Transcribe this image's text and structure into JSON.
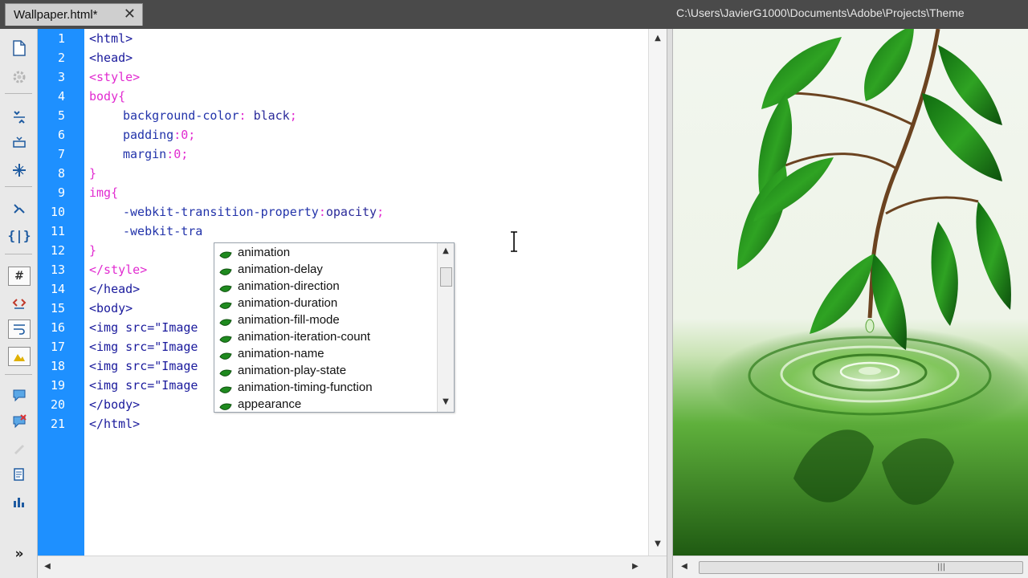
{
  "tab": {
    "label": "Wallpaper.html*",
    "close": "✕"
  },
  "path": "C:\\Users\\JavierG1000\\Documents\\Adobe\\Projects\\Theme",
  "line_numbers": [
    "1",
    "2",
    "3",
    "4",
    "5",
    "6",
    "7",
    "8",
    "9",
    "10",
    "11",
    "12",
    "13",
    "14",
    "15",
    "16",
    "17",
    "18",
    "19",
    "20",
    "21"
  ],
  "code": {
    "l1": "<html>",
    "l2": "<head>",
    "l3": "<style>",
    "l4_sel": "body",
    "l4_brace": "{",
    "l5_prop": "background-color",
    "l5_colon": ": ",
    "l5_val": "black",
    "l5_semi": ";",
    "l6_prop": "padding",
    "l6_colon": ":",
    "l6_val": "0",
    "l6_semi": ";",
    "l7_prop": "margin",
    "l7_colon": ":",
    "l7_val": "0",
    "l7_semi": ";",
    "l8": "}",
    "l9_sel": "img",
    "l9_brace": "{",
    "l10_prop": "-webkit-transition-property",
    "l10_colon": ":",
    "l10_val": "opacity",
    "l10_semi": ";",
    "l11_text": "-webkit-tra",
    "l12": "}",
    "l13": "</style>",
    "l14": "</head>",
    "l15": "<body>",
    "l16": "<img src=\"Image",
    "l17": "<img src=\"Image",
    "l18": "<img src=\"Image",
    "l19": "<img src=\"Image",
    "l20": "</body>",
    "l21": "</html>"
  },
  "code_hints": [
    "animation",
    "animation-delay",
    "animation-direction",
    "animation-duration",
    "animation-fill-mode",
    "animation-iteration-count",
    "animation-name",
    "animation-play-state",
    "animation-timing-function",
    "appearance"
  ],
  "scroll": {
    "up": "▲",
    "down": "▼",
    "left": "◀",
    "right": "▶",
    "grip": "|||"
  },
  "toolbar_more": "»",
  "colors": {
    "gutter": "#1e90ff",
    "tag": "#1a1a9c",
    "selector": "#e12bd0",
    "hint_icon": "#1f8a1f"
  }
}
